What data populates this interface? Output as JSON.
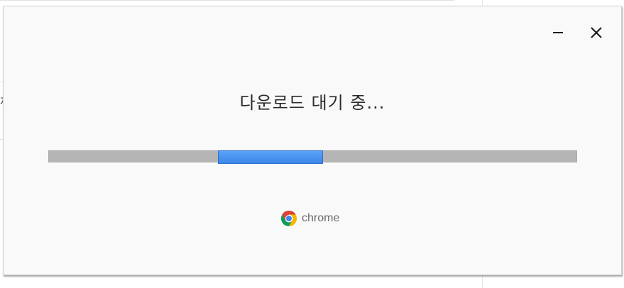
{
  "dialog": {
    "status_text": "다운로드 대기 중...",
    "brand_name": "chrome",
    "progress": {
      "indeterminate": true,
      "accent_color": "#4a94f2"
    },
    "controls": {
      "minimize_icon": "minimize-icon",
      "close_icon": "close-icon"
    }
  },
  "background": {
    "partial_text": "저"
  }
}
